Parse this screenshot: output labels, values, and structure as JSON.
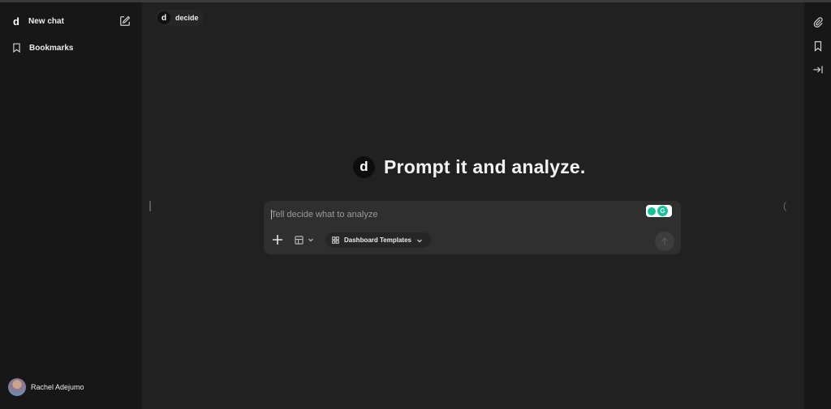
{
  "sidebar": {
    "logo_letter": "d",
    "new_chat_label": "New chat",
    "bookmarks_label": "Bookmarks",
    "user_name": "Rachel Adejumo"
  },
  "tab": {
    "logo_letter": "d",
    "label": "decide"
  },
  "hero": {
    "logo_letter": "d",
    "title": "Prompt it and analyze."
  },
  "composer": {
    "placeholder": "Tell decide what to analyze",
    "value": "",
    "templates_label": "Dashboard Templates",
    "grammarly_letter": "G"
  },
  "icons": {
    "edit": "edit-icon",
    "bookmark": "bookmark-icon",
    "plus": "plus-icon",
    "layout": "grid-layout-icon",
    "templates": "grid-four-icon",
    "send": "arrow-up-icon",
    "attach": "paperclip-icon",
    "rail_bookmark": "bookmark-icon",
    "collapse": "arrow-to-right-icon"
  },
  "colors": {
    "background": "#212121",
    "sidebar": "#171717",
    "composer": "#2f2f2f",
    "grammarly": "#15c39a"
  }
}
